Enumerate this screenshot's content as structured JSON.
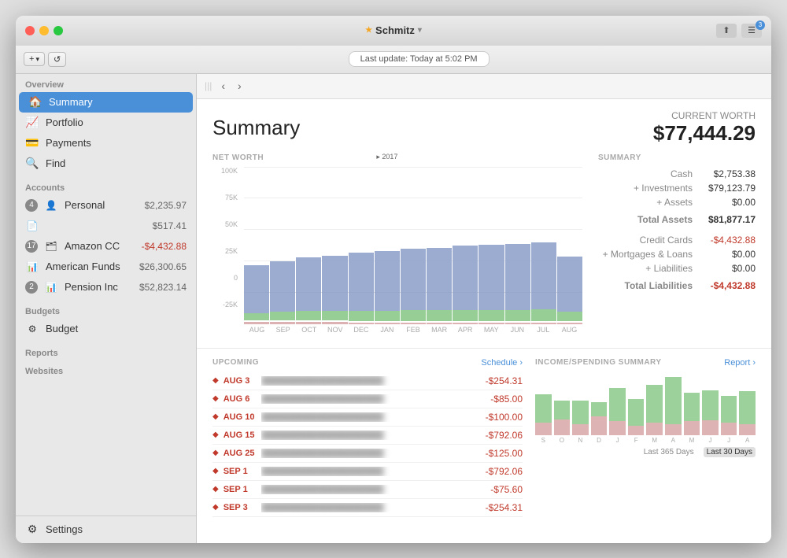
{
  "window": {
    "title": "Schmitz",
    "update_text": "Last update:  Today at 5:02 PM"
  },
  "toolbar": {
    "add_label": "+",
    "refresh_label": "↺"
  },
  "sidebar": {
    "overview_label": "Overview",
    "items": [
      {
        "id": "summary",
        "label": "Summary",
        "icon": "🏠",
        "active": true
      },
      {
        "id": "portfolio",
        "label": "Portfolio",
        "icon": "📈",
        "active": false
      },
      {
        "id": "payments",
        "label": "Payments",
        "icon": "💳",
        "active": false
      },
      {
        "id": "find",
        "label": "Find",
        "icon": "🔍",
        "active": false
      }
    ],
    "accounts_label": "Accounts",
    "accounts": [
      {
        "id": "personal",
        "label": "Personal",
        "badge": "4",
        "value": "$2,235.97",
        "negative": false,
        "icon": "👤"
      },
      {
        "id": "acc2",
        "label": "",
        "badge": "",
        "value": "$517.41",
        "negative": false,
        "icon": "📄"
      },
      {
        "id": "amazon",
        "label": "Amazon CC",
        "badge": "17",
        "value": "-$4,432.88",
        "negative": true,
        "icon": "🗂"
      },
      {
        "id": "american",
        "label": "American Funds",
        "badge": "",
        "value": "$26,300.65",
        "negative": false,
        "icon": "📊"
      },
      {
        "id": "pension",
        "label": "Pension Inc",
        "badge": "2",
        "value": "$52,823.14",
        "negative": false,
        "icon": "📊"
      }
    ],
    "budgets_label": "Budgets",
    "budgets": [
      {
        "id": "budget",
        "label": "Budget",
        "icon": "⚙"
      }
    ],
    "reports_label": "Reports",
    "websites_label": "Websites",
    "settings_label": "Settings"
  },
  "content": {
    "summary_title": "Summary",
    "current_worth_label": "CURRENT WORTH",
    "current_worth_value": "$77,444.29",
    "net_worth_label": "NET WORTH",
    "summary_label": "SUMMARY",
    "summary_items": [
      {
        "label": "Cash",
        "value": "$2,753.38",
        "negative": false
      },
      {
        "label": "+ Investments",
        "value": "$79,123.79",
        "negative": false
      },
      {
        "label": "+ Assets",
        "value": "$0.00",
        "negative": false
      },
      {
        "label": "Total Assets",
        "value": "$81,877.17",
        "negative": false,
        "bold": true
      },
      {
        "label": "Credit Cards",
        "value": "-$4,432.88",
        "negative": true
      },
      {
        "label": "+ Mortgages & Loans",
        "value": "$0.00",
        "negative": false
      },
      {
        "label": "+ Liabilities",
        "value": "$0.00",
        "negative": false
      },
      {
        "label": "Total Liabilities",
        "value": "-$4,432.88",
        "negative": true,
        "bold": true
      }
    ],
    "chart": {
      "y_labels": [
        "100K",
        "75K",
        "50K",
        "25K",
        "0",
        "-25K"
      ],
      "x_labels": [
        "AUG",
        "SEP",
        "OCT",
        "NOV",
        "DEC",
        "JAN",
        "FEB",
        "MAR",
        "APR",
        "MAY",
        "JUN",
        "JUL",
        "AUG"
      ],
      "year_marker": "▸ 2017",
      "bars": [
        {
          "pos": 52,
          "green": 8,
          "neg": 12
        },
        {
          "pos": 55,
          "green": 9,
          "neg": 11
        },
        {
          "pos": 58,
          "green": 10,
          "neg": 10
        },
        {
          "pos": 60,
          "green": 10,
          "neg": 10
        },
        {
          "pos": 63,
          "green": 11,
          "neg": 9
        },
        {
          "pos": 65,
          "green": 11,
          "neg": 9
        },
        {
          "pos": 67,
          "green": 12,
          "neg": 8
        },
        {
          "pos": 68,
          "green": 12,
          "neg": 8
        },
        {
          "pos": 70,
          "green": 12,
          "neg": 9
        },
        {
          "pos": 71,
          "green": 12,
          "neg": 9
        },
        {
          "pos": 72,
          "green": 12,
          "neg": 9
        },
        {
          "pos": 73,
          "green": 13,
          "neg": 9
        },
        {
          "pos": 60,
          "green": 10,
          "neg": 8
        }
      ]
    },
    "upcoming_label": "UPCOMING",
    "schedule_label": "Schedule ›",
    "upcoming_rows": [
      {
        "date": "AUG 3",
        "amount": "-$254.31"
      },
      {
        "date": "AUG 6",
        "amount": "-$85.00"
      },
      {
        "date": "AUG 10",
        "amount": "-$100.00"
      },
      {
        "date": "AUG 15",
        "amount": "-$792.06"
      },
      {
        "date": "AUG 25",
        "amount": "-$125.00"
      },
      {
        "date": "SEP 1",
        "amount": "-$792.06"
      },
      {
        "date": "SEP 1",
        "amount": "-$75.60"
      },
      {
        "date": "SEP 3",
        "amount": "-$254.31"
      }
    ],
    "income_label": "INCOME/SPENDING SUMMARY",
    "report_label": "Report ›",
    "mini_chart": {
      "labels": [
        "S",
        "O",
        "N",
        "D",
        "J",
        "F",
        "M",
        "A",
        "M",
        "J",
        "J",
        "A"
      ],
      "bars": [
        {
          "income": 30,
          "spending": 20
        },
        {
          "income": 20,
          "spending": 25
        },
        {
          "income": 25,
          "spending": 18
        },
        {
          "income": 15,
          "spending": 30
        },
        {
          "income": 35,
          "spending": 22
        },
        {
          "income": 28,
          "spending": 15
        },
        {
          "income": 40,
          "spending": 20
        },
        {
          "income": 50,
          "spending": 18
        },
        {
          "income": 30,
          "spending": 22
        },
        {
          "income": 32,
          "spending": 24
        },
        {
          "income": 28,
          "spending": 20
        },
        {
          "income": 35,
          "spending": 18
        }
      ]
    },
    "period_365": "Last 365 Days",
    "period_30": "Last 30 Days"
  }
}
